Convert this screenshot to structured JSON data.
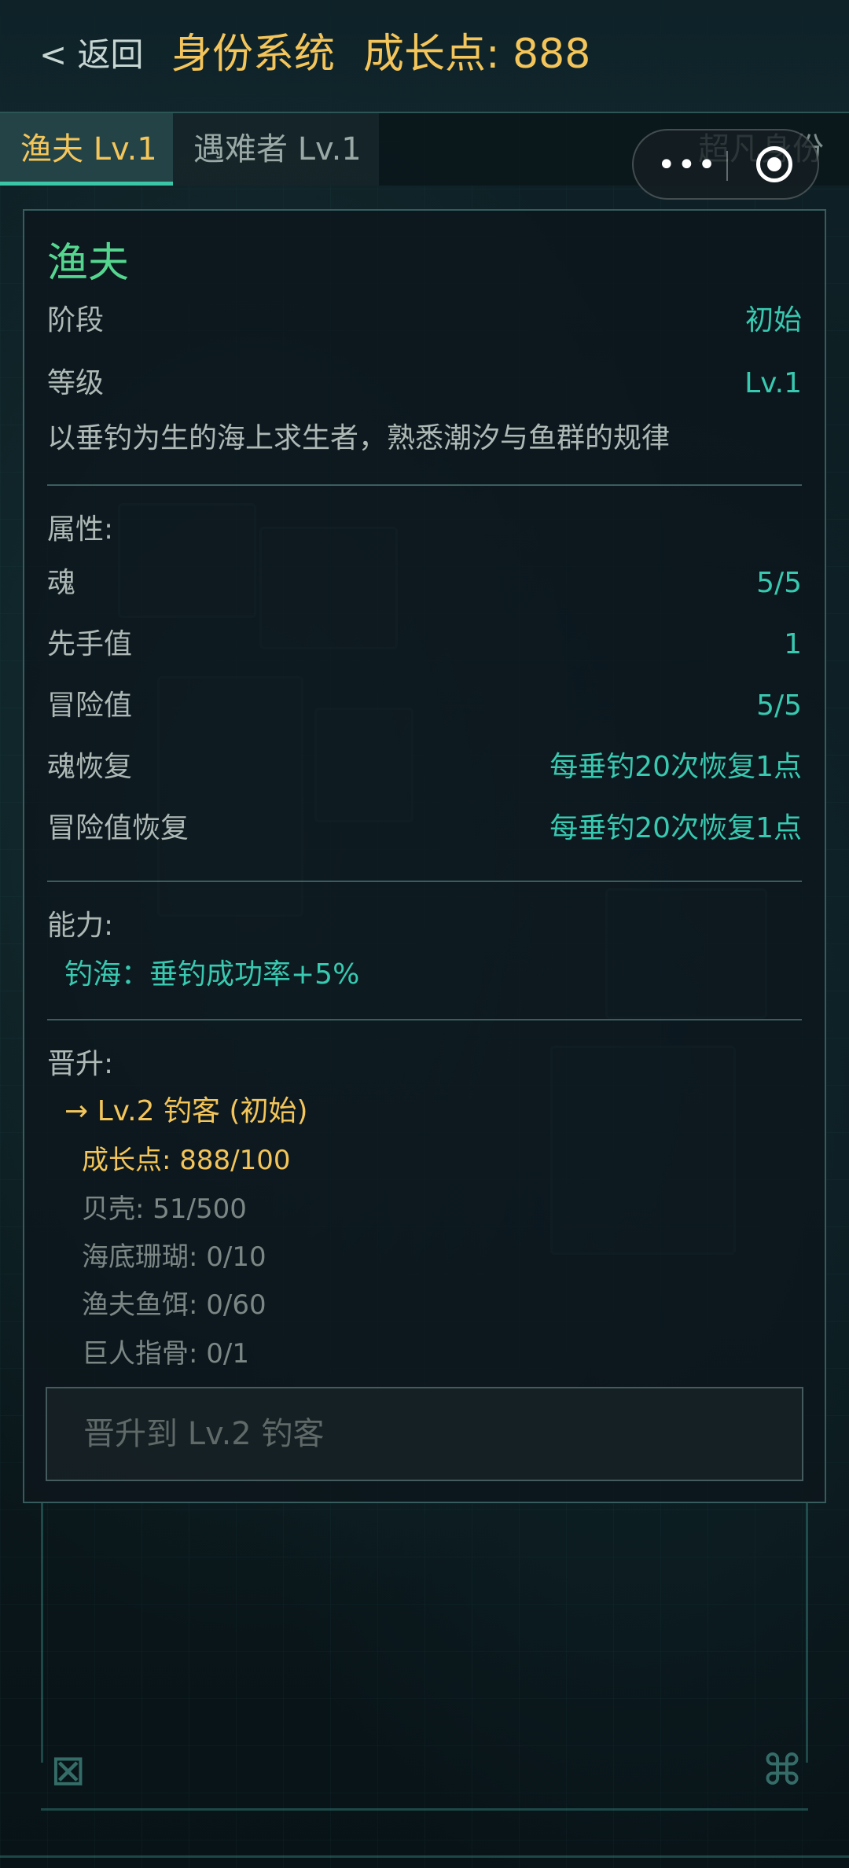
{
  "header": {
    "back_label": "< 返回",
    "title": "身份系统",
    "growth_points": "成长点: 888"
  },
  "tabs": [
    {
      "label": "渔夫 Lv.1",
      "active": true
    },
    {
      "label": "遇难者 Lv.1",
      "active": false
    },
    {
      "label": "超凡身份",
      "active": false
    }
  ],
  "capsule": {
    "menu_icon": "more-dots-icon",
    "close_icon": "target-close-icon"
  },
  "identity": {
    "name": "渔夫",
    "stage_label": "阶段",
    "stage_value": "初始",
    "level_label": "等级",
    "level_value": "Lv.1",
    "description": "以垂钓为生的海上求生者，熟悉潮汐与鱼群的规律"
  },
  "attributes": {
    "title": "属性:",
    "items": [
      {
        "label": "魂",
        "value": "5/5"
      },
      {
        "label": "先手值",
        "value": "1"
      },
      {
        "label": "冒险值",
        "value": "5/5"
      },
      {
        "label": "魂恢复",
        "value": "每垂钓20次恢复1点"
      },
      {
        "label": "冒险值恢复",
        "value": "每垂钓20次恢复1点"
      }
    ]
  },
  "abilities": {
    "title": "能力:",
    "items": [
      "钓海：垂钓成功率+5%"
    ]
  },
  "promotion": {
    "title": "晋升:",
    "target": "→ Lv.2 钓客 (初始)",
    "requirements": [
      {
        "text": "成长点: 888/100",
        "met": true
      },
      {
        "text": "贝壳: 51/500",
        "met": false
      },
      {
        "text": "海底珊瑚: 0/10",
        "met": false
      },
      {
        "text": "渔夫鱼饵: 0/60",
        "met": false
      },
      {
        "text": "巨人指骨: 0/1",
        "met": false
      }
    ],
    "button_label": "晋升到 Lv.2 钓客"
  },
  "colors": {
    "gold": "#f3c55a",
    "green_name": "#55d68f",
    "teal_value": "#38c9b0",
    "label_gray": "#aeb9b6",
    "disabled_gray": "#7c8785"
  }
}
